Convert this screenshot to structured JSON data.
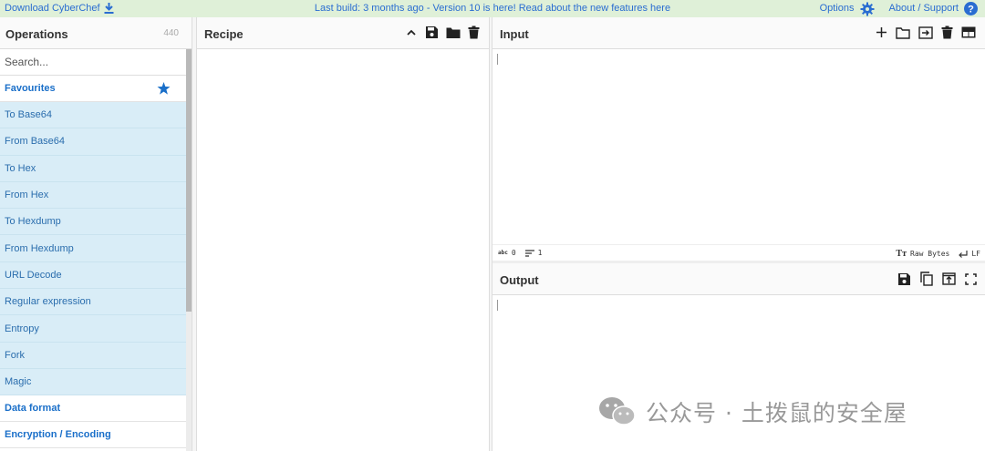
{
  "banner": {
    "download_label": "Download CyberChef",
    "notice": "Last build: 3 months ago - Version 10 is here! Read about the new features here",
    "options_label": "Options",
    "about_label": "About / Support"
  },
  "operations": {
    "title": "Operations",
    "count": "440",
    "search_placeholder": "Search...",
    "favourites_label": "Favourites",
    "items": [
      "To Base64",
      "From Base64",
      "To Hex",
      "From Hex",
      "To Hexdump",
      "From Hexdump",
      "URL Decode",
      "Regular expression",
      "Entropy",
      "Fork",
      "Magic"
    ],
    "categories": [
      "Data format",
      "Encryption / Encoding"
    ]
  },
  "recipe": {
    "title": "Recipe"
  },
  "input": {
    "title": "Input",
    "status_chars": "0",
    "status_lines": "1",
    "status_encoding": "Raw Bytes",
    "status_eol": "LF"
  },
  "output": {
    "title": "Output"
  },
  "watermark": {
    "text": "公众号 · 土拨鼠的安全屋"
  },
  "colors": {
    "banner_bg": "#dff0d8",
    "link": "#2a6dd1",
    "op_bg": "#d9edf7",
    "accent": "#1a6fc9"
  }
}
